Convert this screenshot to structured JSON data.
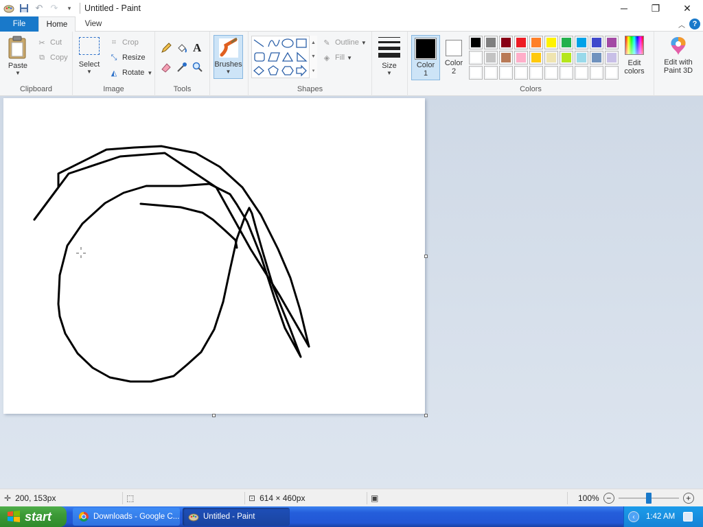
{
  "window": {
    "title": "Untitled - Paint",
    "minimize": "─",
    "restore": "❐",
    "close": "✕"
  },
  "tabs": {
    "file": "File",
    "home": "Home",
    "view": "View"
  },
  "ribbon": {
    "clipboard": {
      "label": "Clipboard",
      "paste": "Paste",
      "cut": "Cut",
      "copy": "Copy"
    },
    "image": {
      "label": "Image",
      "select": "Select",
      "crop": "Crop",
      "resize": "Resize",
      "rotate": "Rotate"
    },
    "tools": {
      "label": "Tools"
    },
    "brushes": "Brushes",
    "shapes": {
      "label": "Shapes",
      "outline": "Outline",
      "fill": "Fill"
    },
    "size": "Size",
    "colors": {
      "label": "Colors",
      "color1": "Color 1",
      "color2": "Color 2",
      "color1_value": "#000000",
      "color2_value": "#ffffff",
      "edit_colors": "Edit colors",
      "edit_3d": "Edit with Paint 3D",
      "palette_row1": [
        "#000000",
        "#7f7f7f",
        "#880015",
        "#ed1c24",
        "#ff7f27",
        "#fff200",
        "#22b14c",
        "#00a2e8",
        "#3f48cc",
        "#a349a4"
      ],
      "palette_row2": [
        "#ffffff",
        "#c3c3c3",
        "#b97a57",
        "#ffaec9",
        "#ffc90e",
        "#efe4b0",
        "#b5e61d",
        "#99d9ea",
        "#7092be",
        "#c8bfe7"
      ],
      "palette_row3": [
        "#ffffff",
        "#ffffff",
        "#ffffff",
        "#ffffff",
        "#ffffff",
        "#ffffff",
        "#ffffff",
        "#ffffff",
        "#ffffff",
        "#ffffff"
      ]
    }
  },
  "status": {
    "cursor_pos": "200, 153px",
    "canvas_size": "614 × 460px",
    "zoom": "100%",
    "zoom_level": 0.5
  },
  "taskbar": {
    "start": "start",
    "tasks": [
      "Downloads - Google C...",
      "Untitled - Paint"
    ],
    "time": "1:42 AM"
  }
}
